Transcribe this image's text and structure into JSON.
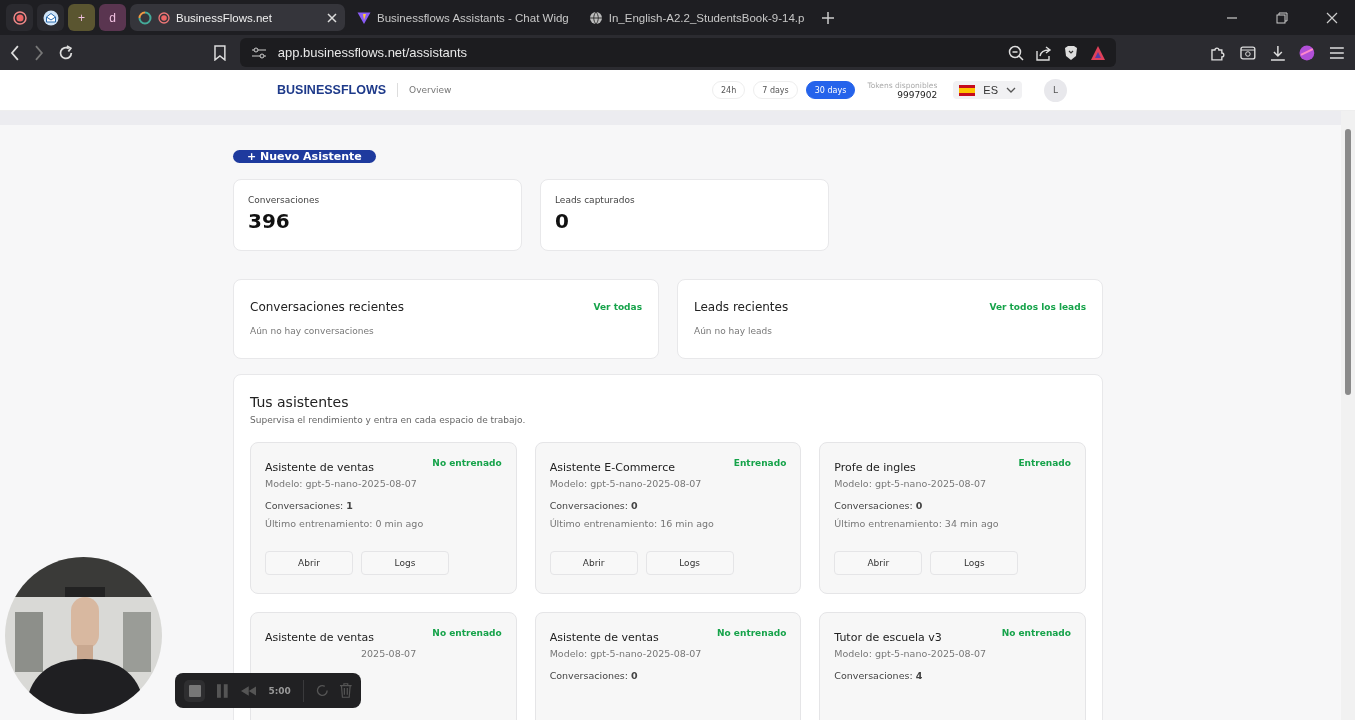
{
  "browser": {
    "pinned_tabs": [
      {
        "kind": "record"
      },
      {
        "kind": "mail"
      },
      {
        "kind": "letter",
        "label": "+",
        "color": "#5a5530"
      },
      {
        "kind": "letter",
        "label": "d",
        "color": "#5a3550"
      }
    ],
    "tabs": [
      {
        "label": "BusinessFlows.net",
        "selected": true
      },
      {
        "label": "Businessflows Assistants - Chat Widg",
        "selected": false
      },
      {
        "label": "In_English-A2.2_StudentsBook-9-14.p",
        "selected": false
      }
    ],
    "address": "app.businessflows.net/assistants"
  },
  "header": {
    "logo": "BUSINESSFLOWS",
    "section": "Overview",
    "ranges": [
      {
        "label": "24h",
        "selected": false
      },
      {
        "label": "7 days",
        "selected": false
      },
      {
        "label": "30 days",
        "selected": true
      }
    ],
    "tokens_label": "Tokens disponibles",
    "tokens_value": "9997902",
    "language": "ES",
    "avatar": "L"
  },
  "new_button": "+ Nuevo Asistente",
  "stats": [
    {
      "label": "Conversaciones",
      "value": "396"
    },
    {
      "label": "Leads capturados",
      "value": "0"
    }
  ],
  "recent": [
    {
      "title": "Conversaciones recientes",
      "link": "Ver todas",
      "empty": "Aún no hay conversaciones"
    },
    {
      "title": "Leads recientes",
      "link": "Ver todos los leads",
      "empty": "Aún no hay leads"
    }
  ],
  "assistants": {
    "title": "Tus asistentes",
    "subtitle": "Supervisa el rendimiento y entra en cada espacio de trabajo.",
    "cards": [
      {
        "name": "Asistente de ventas",
        "status": "No entrenado",
        "model": "Modelo: gpt-5-nano-2025-08-07",
        "conv_label": "Conversaciones:",
        "conv_value": "1",
        "trained": "Último entrenamiento: 0 min ago",
        "actions": [
          "Abrir",
          "Logs"
        ]
      },
      {
        "name": "Asistente E-Commerce",
        "status": "Entrenado",
        "model": "Modelo: gpt-5-nano-2025-08-07",
        "conv_label": "Conversaciones:",
        "conv_value": "0",
        "trained": "Último entrenamiento: 16 min ago",
        "actions": [
          "Abrir",
          "Logs"
        ]
      },
      {
        "name": "Profe de ingles",
        "status": "Entrenado",
        "model": "Modelo: gpt-5-nano-2025-08-07",
        "conv_label": "Conversaciones:",
        "conv_value": "0",
        "trained": "Último entrenamiento: 34 min ago",
        "actions": [
          "Abrir",
          "Logs"
        ]
      },
      {
        "name": "Asistente de ventas",
        "status": "No entrenado",
        "model": "2025-08-07",
        "model_covered": true
      },
      {
        "name": "Asistente de ventas",
        "status": "No entrenado",
        "model": "Modelo: gpt-5-nano-2025-08-07",
        "conv_label": "Conversaciones:",
        "conv_value": "0"
      },
      {
        "name": "Tutor de escuela v3",
        "status": "No entrenado",
        "model": "Modelo: gpt-5-nano-2025-08-07",
        "conv_label": "Conversaciones:",
        "conv_value": "4"
      }
    ]
  },
  "recorder": {
    "time": "5:00"
  }
}
